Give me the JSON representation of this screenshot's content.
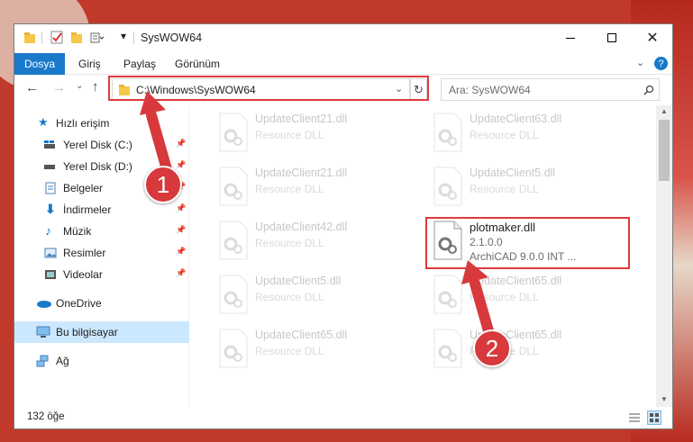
{
  "window": {
    "title": "SysWOW64"
  },
  "ribbon": {
    "tabs": [
      "Dosya",
      "Giriş",
      "Paylaş",
      "Görünüm"
    ]
  },
  "address": {
    "path": "C:\\Windows\\SysWOW64"
  },
  "search": {
    "placeholder": "Ara: SysWOW64"
  },
  "sidebar": {
    "quick_access": "Hızlı erişim",
    "items": [
      "Yerel Disk (C:)",
      "Yerel Disk (D:)",
      "Belgeler",
      "İndirmeler",
      "Müzik",
      "Resimler",
      "Videolar"
    ],
    "onedrive": "OneDrive",
    "this_pc": "Bu bilgisayar",
    "network": "Ağ"
  },
  "files": [
    {
      "name": "UpdateClient21.dll",
      "desc": "Resource DLL"
    },
    {
      "name": "UpdateClient63.dll",
      "desc": "Resource DLL"
    },
    {
      "name": "UpdateClient21.dll",
      "desc": "Resource DLL"
    },
    {
      "name": "UpdateClient5.dll",
      "desc": "Resource DLL"
    },
    {
      "name": "UpdateClient42.dll",
      "desc": "Resource DLL"
    },
    {
      "name": "plotmaker.dll",
      "version": "2.1.0.0",
      "desc": "ArchiCAD 9.0.0 INT ..."
    },
    {
      "name": "UpdateClient5.dll",
      "desc": "Resource DLL"
    },
    {
      "name": "UpdateClient65.dll",
      "desc": "Resource DLL"
    },
    {
      "name": "UpdateClient65.dll",
      "desc": "Resource DLL"
    },
    {
      "name": "UpdateClient65.dll",
      "desc": "Resource DLL"
    }
  ],
  "status": {
    "count": "132 öğe"
  },
  "annotations": {
    "step1": "1",
    "step2": "2"
  },
  "colors": {
    "accent": "#1979ca",
    "highlight": "#e0393e",
    "selected_nav": "#cce8ff"
  }
}
